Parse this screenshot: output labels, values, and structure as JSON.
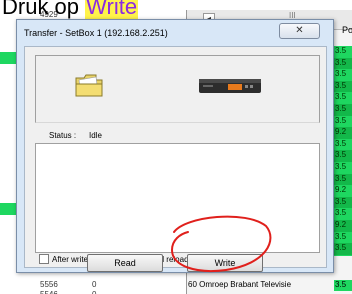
{
  "caption": {
    "prefix": "Druk op ",
    "highlight": "Write"
  },
  "background": {
    "rows": [
      {
        "c1": "4929",
        "c2": "0"
      },
      {
        "c1": "5556",
        "c2": "0"
      },
      {
        "c1": "5546",
        "c2": "0"
      }
    ],
    "right_header_scroll": "◂",
    "right_header_mid": "III",
    "col_header": "Po",
    "col_values": [
      "3.5",
      "3.5",
      "3.5",
      "3.5",
      "3.5",
      "3.5",
      "3.5",
      "9.2",
      "3.5",
      "3.5",
      "3.5",
      "3.5",
      "9.2",
      "3.5",
      "3.5",
      "9.2",
      "3.5",
      "3.5"
    ],
    "bottom_channel": "60 Omroep Brabant Televisie",
    "bottom_value": "3.5"
  },
  "dialog": {
    "title": "Transfer - SetBox 1 (192.168.2.251)",
    "close_label": "✕",
    "status_label": "Status :",
    "status_value": "Idle",
    "checkbox_label": "After write settings, do not send reload/reboot command",
    "checkbox_checked": false,
    "read_label": "Read",
    "write_label": "Write"
  },
  "colors": {
    "highlight_bg": "#fff34a",
    "highlight_text": "#8a2be2",
    "green": "#1ed760",
    "circle": "#e0201c"
  }
}
